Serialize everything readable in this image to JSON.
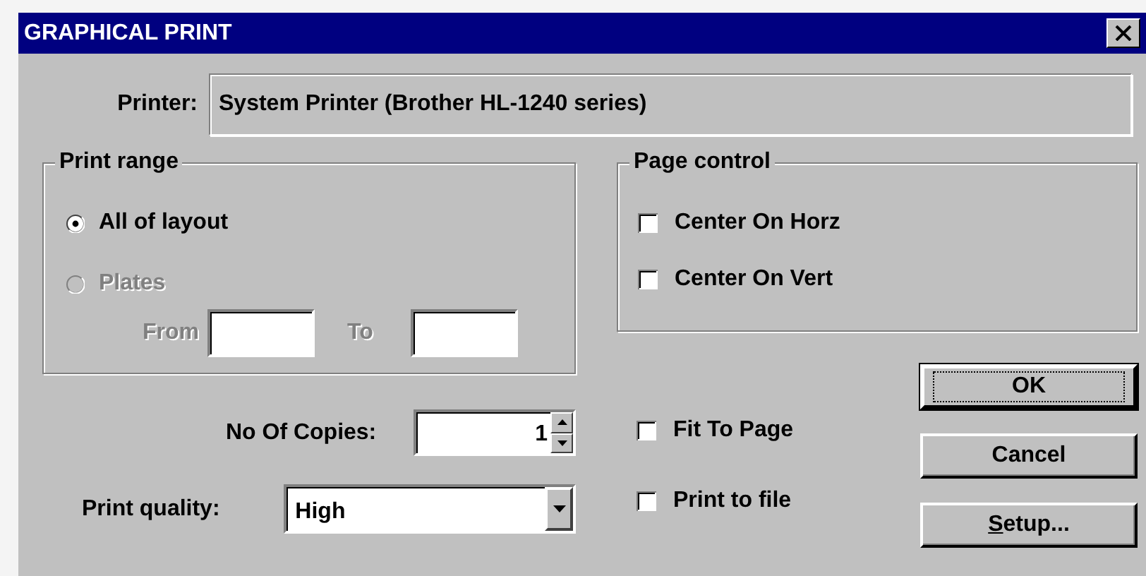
{
  "window": {
    "title": "GRAPHICAL PRINT"
  },
  "printer": {
    "label": "Printer:",
    "value": "System Printer (Brother HL-1240 series)"
  },
  "print_range": {
    "title": "Print range",
    "options": [
      {
        "label": "All of layout",
        "selected": true,
        "disabled": false
      },
      {
        "label": "Plates",
        "selected": false,
        "disabled": true
      }
    ],
    "from": {
      "label": "From",
      "disabled": true
    },
    "to": {
      "label": "To",
      "disabled": true
    }
  },
  "page_control": {
    "title": "Page control",
    "options": [
      {
        "label": "Center On Horz",
        "checked": false
      },
      {
        "label": "Center On Vert",
        "checked": false
      }
    ]
  },
  "copies": {
    "label": "No Of Copies:",
    "value": "1"
  },
  "quality": {
    "label": "Print quality:",
    "value": "High"
  },
  "options": [
    {
      "label": "Fit To Page",
      "checked": false
    },
    {
      "label": "Print to file",
      "checked": false
    }
  ],
  "buttons": [
    {
      "label": "OK",
      "default": true
    },
    {
      "label": "Cancel",
      "default": false
    },
    {
      "label": "Setup...",
      "default": false,
      "first_letter_underlined": true
    }
  ]
}
